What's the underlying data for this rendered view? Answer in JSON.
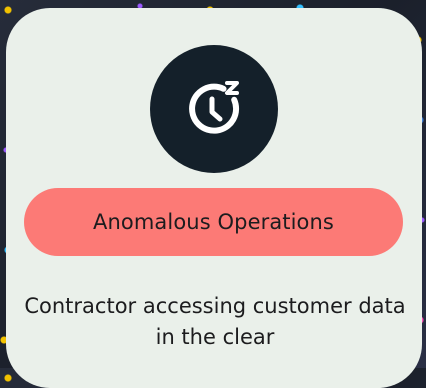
{
  "card": {
    "icon": "clock-snooze-icon",
    "category_label": "Anomalous Operations",
    "description": "Contractor accessing customer data in the clear"
  },
  "colors": {
    "card_background": "#eaf0ea",
    "icon_circle": "#14202a",
    "pill_background": "#fc7a76",
    "text": "#1c1c1e"
  }
}
